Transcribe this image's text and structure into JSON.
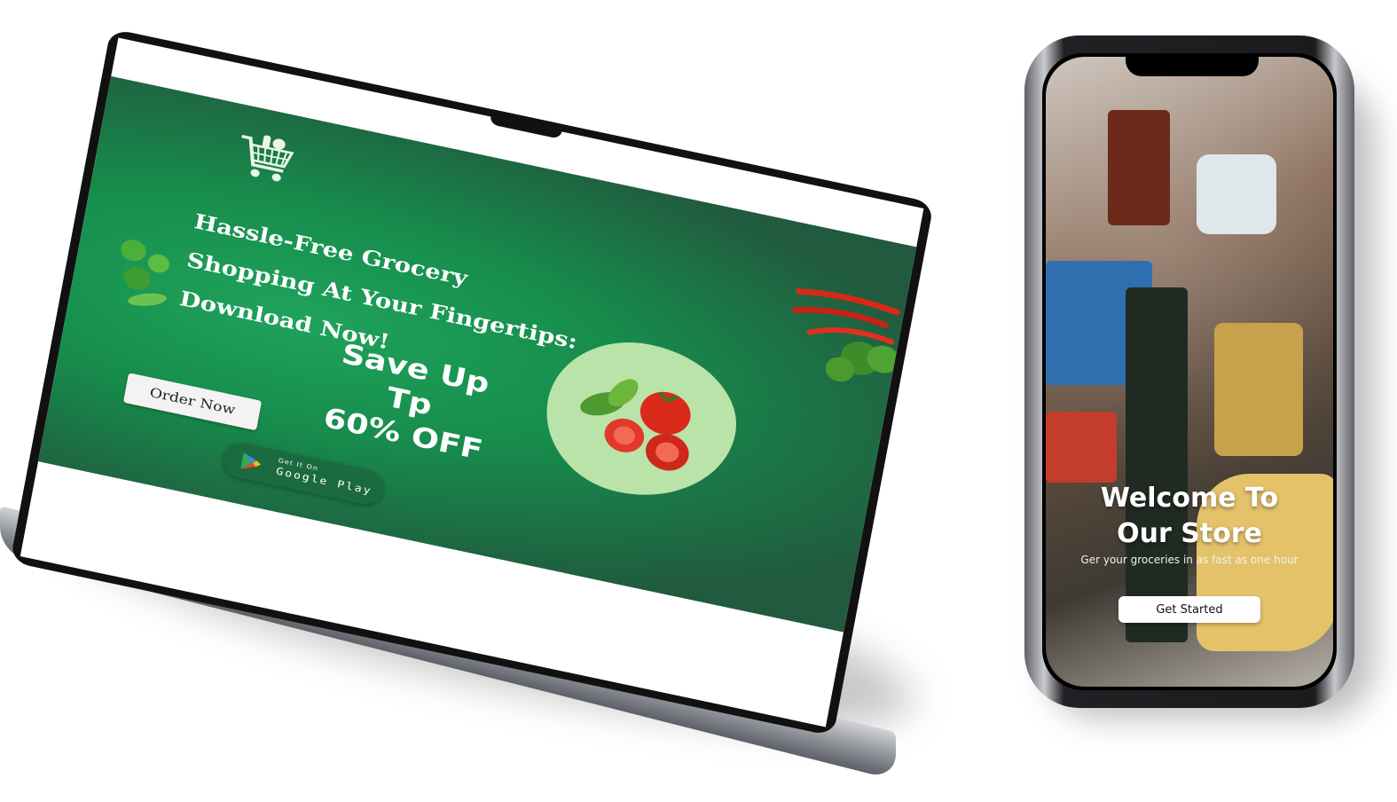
{
  "laptop": {
    "banner": {
      "title": "Hassle-Free Grocery Shopping At Your Fingertips: Download Now!",
      "promo_line1": "Save Up Tp",
      "promo_line2": "60% OFF",
      "order_button": "Order Now",
      "store_badge": {
        "small_text": "Get It On",
        "big_text": "Google Play",
        "icon": "google-play-icon"
      },
      "colors": {
        "banner_green": "#178c4c",
        "banner_dark": "#215a3e",
        "blob": "#b9e3a8"
      }
    },
    "icons": [
      "shopping-cart-logo-icon",
      "tomato-basil-icon",
      "chili-pepper-icon",
      "leafy-greens-icon"
    ]
  },
  "phone": {
    "welcome_line1": "Welcome To",
    "welcome_line2": "Our Store",
    "subtitle": "Ger your groceries in as fast as one hour",
    "cta_button": "Get Started"
  }
}
